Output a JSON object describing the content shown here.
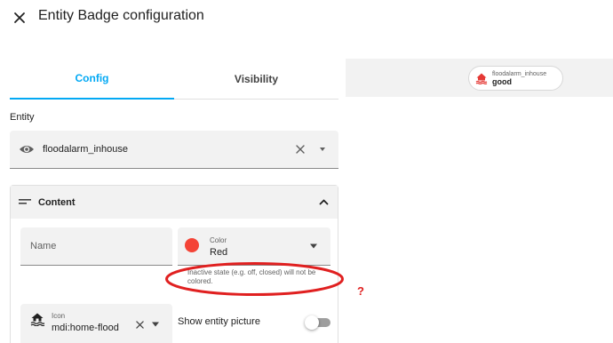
{
  "dialog": {
    "title": "Entity Badge configuration",
    "close_icon": "close-icon"
  },
  "tabs": [
    {
      "label": "Config",
      "active": true
    },
    {
      "label": "Visibility",
      "active": false
    }
  ],
  "preview": {
    "badge_name": "floodalarm_inhouse",
    "badge_state": "good",
    "badge_icon": "home-flood-icon",
    "badge_icon_color": "#e53935"
  },
  "entity": {
    "label": "Entity",
    "value": "floodalarm_inhouse",
    "icon": "eye-icon"
  },
  "content_panel": {
    "title": "Content",
    "expanded": true,
    "name_field": {
      "placeholder": "Name",
      "value": ""
    },
    "color_field": {
      "label": "Color",
      "value": "Red",
      "swatch": "#f44336"
    },
    "color_helper": "Inactive state (e.g. off, closed) will not be colored.",
    "icon_field": {
      "label": "Icon",
      "value": "mdi:home-flood"
    },
    "show_entity_picture": {
      "label": "Show entity picture",
      "checked": false
    }
  },
  "annotation": {
    "question_mark": "?",
    "color": "#e02020"
  },
  "colors": {
    "accent": "#03a9f4",
    "field_bg": "#f2f2f2"
  }
}
